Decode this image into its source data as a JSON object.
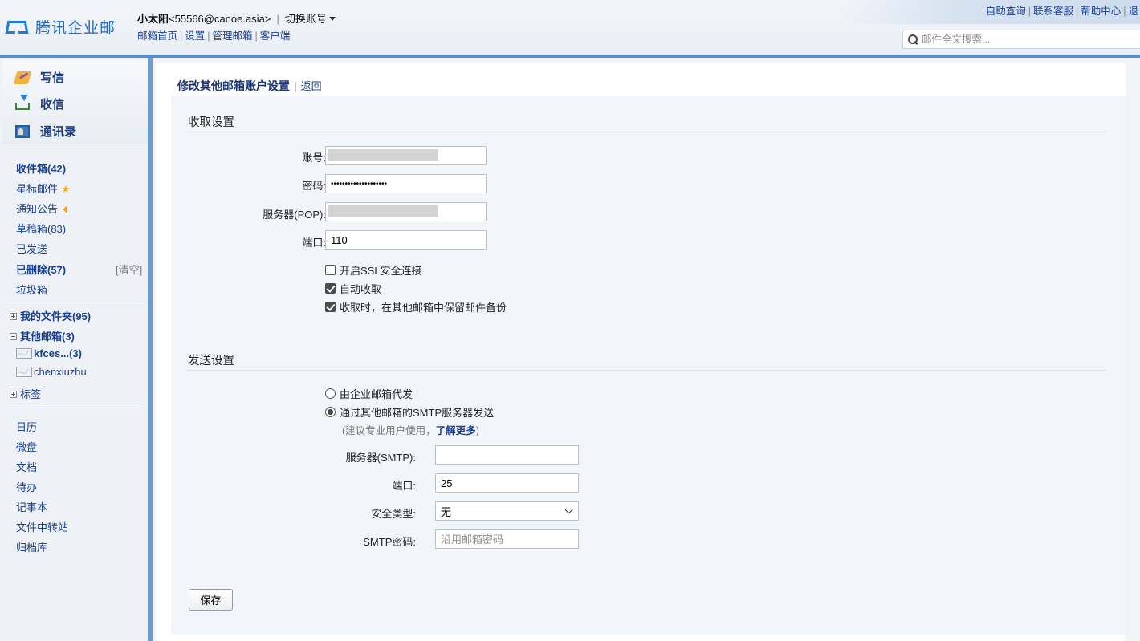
{
  "brand": {
    "name": "腾讯企业邮",
    "accent": "#1c6ccd"
  },
  "header": {
    "user_name": "小太阳",
    "user_email": "<55566@canoe.asia>",
    "separator": "|",
    "switch_account": "切换账号",
    "links": [
      "邮箱首页",
      "设置",
      "管理邮箱",
      "客户端"
    ],
    "top_links": [
      "自助查询",
      "联系客服",
      "帮助中心",
      "退"
    ],
    "search_placeholder": "邮件全文搜索..."
  },
  "sidebar": {
    "actions": {
      "compose": "写信",
      "receive": "收信",
      "contacts": "通讯录"
    },
    "folders": {
      "inbox": "收件箱(42)",
      "starred": "星标邮件",
      "notices": "通知公告",
      "drafts": "草稿箱(83)",
      "sent": "已发送",
      "deleted": "已删除(57)",
      "empty": "[清空]",
      "spam": "垃圾箱"
    },
    "my_folders": "我的文件夹(95)",
    "other_mailboxes": "其他邮箱(3)",
    "other_accounts": [
      "kfces...(3)",
      "chenxiuzhu"
    ],
    "tags": "标签",
    "apps": [
      "日历",
      "微盘",
      "文档",
      "待办",
      "记事本",
      "文件中转站",
      "归档库"
    ]
  },
  "page": {
    "title": "修改其他邮箱账户设置",
    "separator": "|",
    "back": "返回",
    "receive_section": "收取设置",
    "fields": {
      "account_label": "账号:",
      "password_label": "密码:",
      "password_value": "••••••••••••••••••••",
      "pop_server_label": "服务器(POP):",
      "pop_port_label": "端口:",
      "pop_port_value": "110"
    },
    "options": {
      "ssl": "开启SSL安全连接",
      "auto_receive": "自动收取",
      "keep_backup": "收取时，在其他邮箱中保留邮件备份"
    },
    "send_section": "发送设置",
    "send_options": {
      "enterprise": "由企业邮箱代发",
      "smtp": "通过其他邮箱的SMTP服务器发送"
    },
    "hint_prefix": "(建议专业用户使用，",
    "hint_link": "了解更多",
    "hint_suffix": ")",
    "smtp": {
      "server_label": "服务器(SMTP):",
      "server_value": "",
      "port_label": "端口:",
      "port_value": "25",
      "security_label": "安全类型:",
      "security_value": "无",
      "password_label": "SMTP密码:",
      "password_placeholder": "沿用邮箱密码"
    },
    "save": "保存"
  }
}
